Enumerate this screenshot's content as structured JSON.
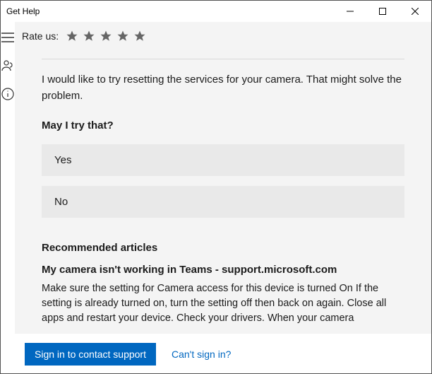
{
  "window": {
    "title": "Get Help"
  },
  "rate": {
    "label": "Rate us:"
  },
  "chat": {
    "message": "I would like to try resetting the services for your camera. That might solve the problem.",
    "question": "May I try that?",
    "options": {
      "yes": "Yes",
      "no": "No"
    }
  },
  "recommended": {
    "heading": "Recommended articles",
    "article": {
      "title": "My camera isn't working in Teams - support.microsoft.com",
      "body": "Make sure the setting for Camera access for this device is turned On If the setting is already turned on, turn the setting off then back on again. Close all apps and restart your device. Check your drivers. When your camera"
    }
  },
  "footer": {
    "signin": "Sign in to contact support",
    "cant": "Can't sign in?"
  }
}
